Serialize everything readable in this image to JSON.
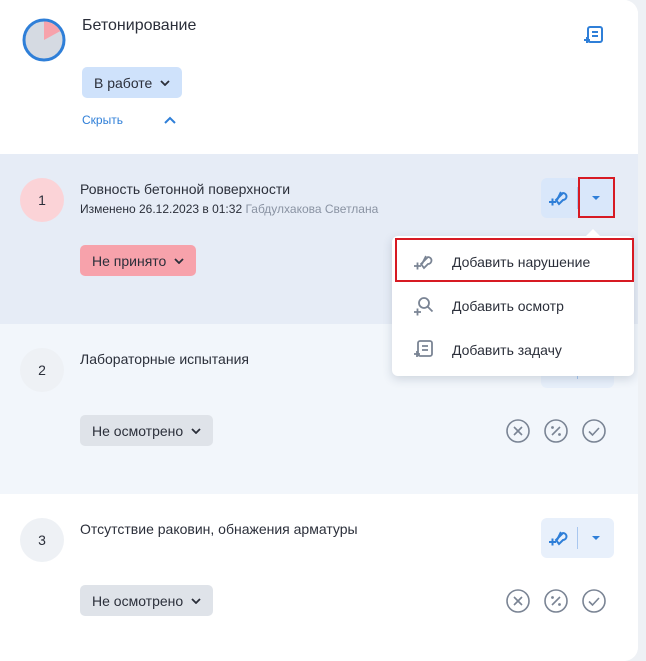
{
  "header": {
    "title": "Бетонирование",
    "progress_fraction": 0.17,
    "status_label": "В работе",
    "hide_label": "Скрыть"
  },
  "items": [
    {
      "number": "1",
      "title": "Ровность бетонной поверхности",
      "meta_changed": "Изменено  26.12.2023 в 01:32",
      "meta_author": "Габдулхакова Светлана",
      "status_label": "Не принято"
    },
    {
      "number": "2",
      "title": "Лабораторные испытания",
      "status_label": "Не осмотрено"
    },
    {
      "number": "3",
      "title": "Отсутствие раковин, обнажения арматуры",
      "status_label": "Не осмотрено"
    }
  ],
  "menu": {
    "items": [
      {
        "label": "Добавить нарушение",
        "icon": "add-violation-icon"
      },
      {
        "label": "Добавить осмотр",
        "icon": "add-inspection-icon"
      },
      {
        "label": "Добавить задачу",
        "icon": "add-task-icon"
      }
    ]
  },
  "colors": {
    "accent": "#2f7fd8",
    "status_in_work": "#cfe2fb",
    "status_rejected": "#f7a2ab",
    "status_not_inspected": "#dfe3e9",
    "highlight": "#d71a23",
    "progress_fill": "#f7a2ab"
  }
}
